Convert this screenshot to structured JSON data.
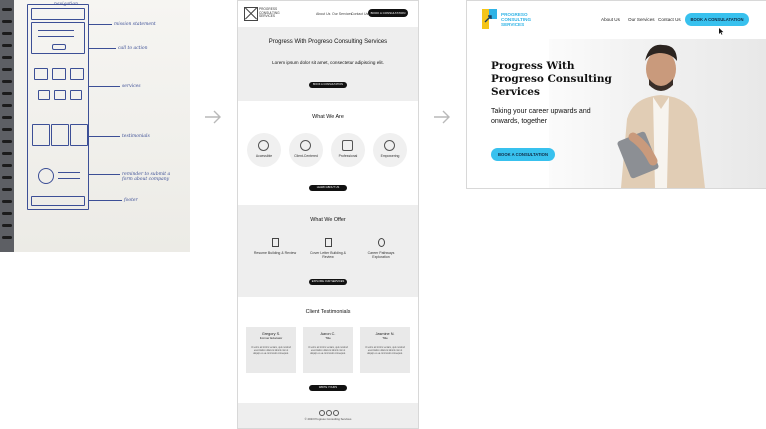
{
  "sketch": {
    "notes": [
      "navigation",
      "mission statement",
      "call to action",
      "services",
      "testimonials",
      "reminder to submit a form about company",
      "footer"
    ]
  },
  "wireframe": {
    "logo_text": "PROGRESS CONSULTING SERVICES",
    "nav": [
      "About Us",
      "Our Services",
      "Contact Us"
    ],
    "nav_button": "BOOK A CONSULTATION",
    "hero": {
      "title": "Progress With Progreso Consulting Services",
      "subtitle": "Lorem ipsum dolor sit amet, consectetur adipiscing elit.",
      "button": "BOOK A CONSULTATION"
    },
    "what_we_are": {
      "title": "What We Are",
      "items": [
        "Accessible",
        "Client-Centered",
        "Professional",
        "Empowering"
      ],
      "button": "LEARN ABOUT US"
    },
    "what_we_offer": {
      "title": "What We Offer",
      "items": [
        "Resume Building & Review",
        "Cover Letter Building & Review",
        "Career Pathways Exploration"
      ],
      "button": "EXPLORE OUR SERVICES"
    },
    "testimonials": {
      "title": "Client Testimonials",
      "cards": [
        {
          "name": "Gregory S.",
          "role": "Former Educator"
        },
        {
          "name": "Aaron C.",
          "role": "Title"
        },
        {
          "name": "Jasmine N.",
          "role": "Title"
        }
      ],
      "body": "Ut enim ad minim veniam, quis nostrud exercitation ullamco laboris nisi ut aliquip ex ea commodo consequat.",
      "button": "WRITE YOURS"
    },
    "footer": "© 2023 Progreso Consulting Services"
  },
  "final": {
    "logo_text": "PROGRESO CONSULTING SERVICES",
    "nav": [
      "About Us",
      "Our Services",
      "Contact Us"
    ],
    "nav_button": "BOOK A CONSULATATION",
    "headline": "Progress With Progreso Consulting Services",
    "subheadline": "Taking your career upwards and onwards, together",
    "cta": "BOOK A CONSULTATION",
    "colors": {
      "accent": "#38c1ee",
      "logo_yellow": "#f5c518",
      "logo_blue": "#2fb3e6"
    }
  }
}
